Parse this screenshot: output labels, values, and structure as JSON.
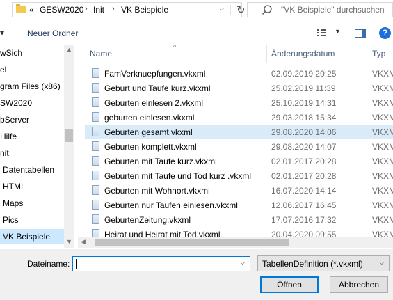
{
  "address": {
    "overflow": "«",
    "crumbs": [
      "GESW2020",
      "Init",
      "VK Beispiele"
    ],
    "separator": "›",
    "dropdown": "⌵",
    "refresh": "↻"
  },
  "search": {
    "placeholder": "\"VK Beispiele\" durchsuchen"
  },
  "toolbar": {
    "left_partial": "▾",
    "new_folder": "Neuer Ordner",
    "view_drop": "▼",
    "help": "?"
  },
  "nav": {
    "items": [
      {
        "label": "wSich"
      },
      {
        "label": "el"
      },
      {
        "label": "gram Files (x86)"
      },
      {
        "label": "SW2020"
      },
      {
        "label": "bServer"
      },
      {
        "label": "Hilfe"
      },
      {
        "label": "nit"
      },
      {
        "label": "Datentabellen"
      },
      {
        "label": "HTML"
      },
      {
        "label": "Maps"
      },
      {
        "label": "Pics"
      },
      {
        "label": "VK Beispiele"
      }
    ]
  },
  "list": {
    "columns": {
      "name": "Name",
      "date": "Änderungsdatum",
      "type": "Typ"
    },
    "rows": [
      {
        "name": "FamVerknuepfungen.vkxml",
        "date": "02.09.2019 20:25",
        "type": "VKXM"
      },
      {
        "name": "Geburt und Taufe kurz.vkxml",
        "date": "25.02.2019 11:39",
        "type": "VKXM"
      },
      {
        "name": "Geburten einlesen 2.vkxml",
        "date": "25.10.2019 14:31",
        "type": "VKXM"
      },
      {
        "name": "geburten einlesen.vkxml",
        "date": "29.03.2018 15:34",
        "type": "VKXM"
      },
      {
        "name": "Geburten gesamt.vkxml",
        "date": "29.08.2020 14:06",
        "type": "VKXM"
      },
      {
        "name": "Geburten komplett.vkxml",
        "date": "29.08.2020 14:07",
        "type": "VKXM"
      },
      {
        "name": "Geburten mit Taufe kurz.vkxml",
        "date": "02.01.2017 20:28",
        "type": "VKXM"
      },
      {
        "name": "Geburten mit Taufe und Tod kurz .vkxml",
        "date": "02.01.2017 20:28",
        "type": "VKXM"
      },
      {
        "name": "Geburten mit Wohnort.vkxml",
        "date": "16.07.2020 14:14",
        "type": "VKXM"
      },
      {
        "name": "Geburten nur Taufen  einlesen.vkxml",
        "date": "12.06.2017 16:45",
        "type": "VKXM"
      },
      {
        "name": "GeburtenZeitung.vkxml",
        "date": "17.07.2016 17:32",
        "type": "VKXM"
      },
      {
        "name": "Heirat und Heirat mit Tod.vkxml",
        "date": "20.04.2020 09:55",
        "type": "VKXM"
      }
    ]
  },
  "bottom": {
    "filename_label": "Dateiname:",
    "filename_value": "",
    "filetype": "TabellenDefinition (*.vkxml)",
    "open": "Öffnen",
    "cancel": "Abbrechen"
  }
}
